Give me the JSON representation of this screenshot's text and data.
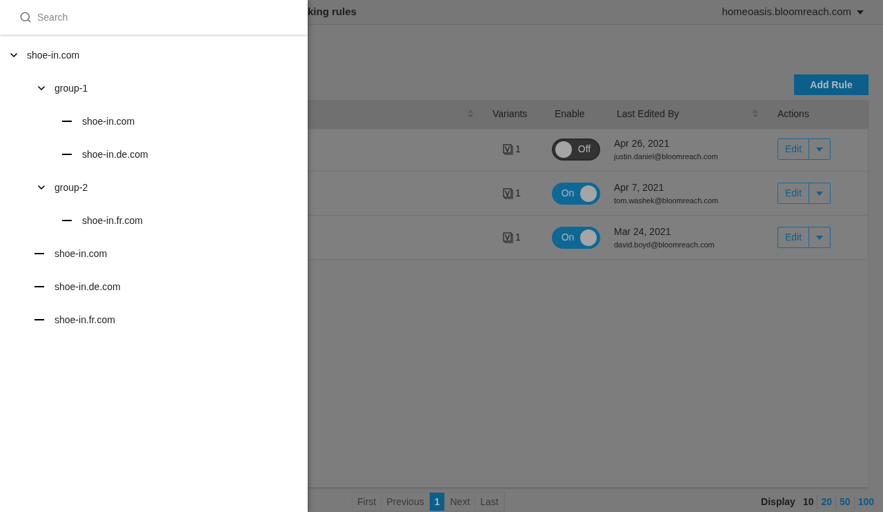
{
  "search": {
    "placeholder": "Search"
  },
  "tree": [
    {
      "label": "shoe-in.com",
      "expanded": true,
      "children": [
        {
          "label": "group-1",
          "expanded": true,
          "children": [
            {
              "label": "shoe-in.com"
            },
            {
              "label": "shoe-in.de.com"
            }
          ]
        },
        {
          "label": "group-2",
          "expanded": true,
          "children": [
            {
              "label": "shoe-in.fr.com"
            }
          ]
        },
        {
          "label": "shoe-in.com"
        },
        {
          "label": "shoe-in.de.com"
        },
        {
          "label": "shoe-in.fr.com"
        }
      ]
    }
  ],
  "header": {
    "page_title": "king rules",
    "account": "homeoasis.bloomreach.com"
  },
  "add_rule_button": "Add Rule",
  "table": {
    "columns": [
      {
        "sortable": true
      },
      {
        "label": "Variants",
        "sortable": false
      },
      {
        "label": "Enable",
        "sortable": false
      },
      {
        "label": "Last Edited By",
        "sortable": true
      },
      {
        "label": "Actions",
        "sortable": false
      }
    ],
    "rows": [
      {
        "variants": "1",
        "enabled": false,
        "toggle_label": "Off",
        "date": "Apr 26, 2021",
        "editor": "justin.daniel@bloomreach.com",
        "action": "Edit"
      },
      {
        "variants": "1",
        "enabled": true,
        "toggle_label": "On",
        "date": "Apr 7, 2021",
        "editor": "tom.washek@bloomreach.com",
        "action": "Edit"
      },
      {
        "variants": "1",
        "enabled": true,
        "toggle_label": "On",
        "date": "Mar 24, 2021",
        "editor": "david.boyd@bloomreach.com",
        "action": "Edit"
      }
    ]
  },
  "pagination": [
    {
      "label": "First",
      "selected": false
    },
    {
      "label": "Previous",
      "selected": false
    },
    {
      "label": "1",
      "selected": true
    },
    {
      "label": "Next",
      "selected": false
    },
    {
      "label": "Last",
      "selected": false
    }
  ],
  "display": {
    "label": "Display",
    "options": [
      {
        "label": "10",
        "selected": true
      },
      {
        "label": "20",
        "selected": false
      },
      {
        "label": "50",
        "selected": false
      },
      {
        "label": "100",
        "selected": false
      }
    ]
  }
}
